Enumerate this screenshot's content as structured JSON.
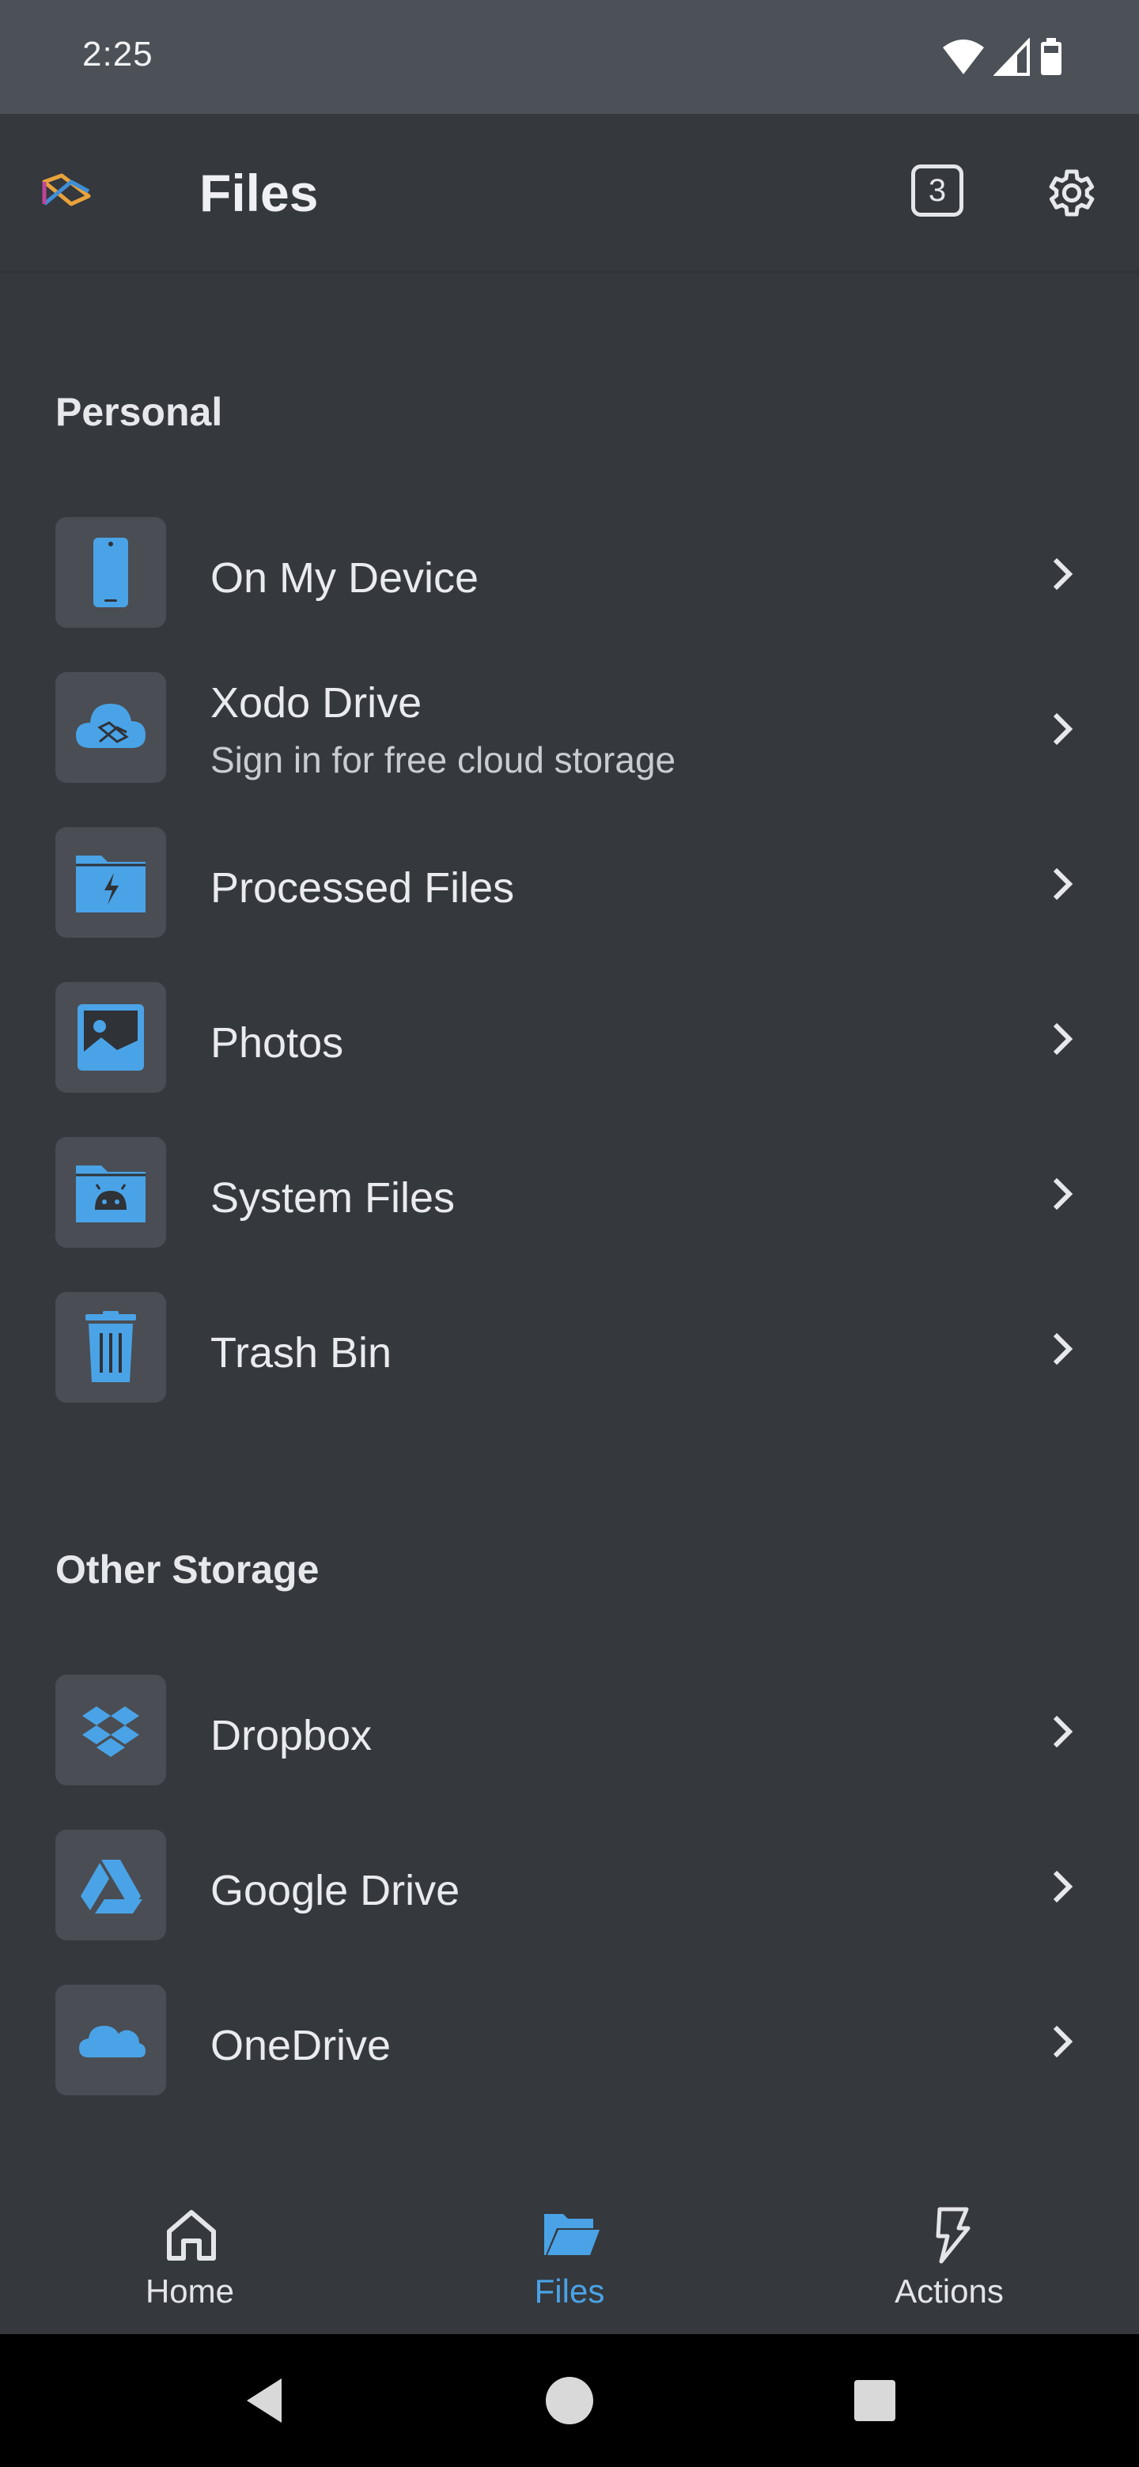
{
  "status_bar": {
    "time": "2:25"
  },
  "app_bar": {
    "title": "Files",
    "tab_count": "3"
  },
  "sections": {
    "personal": {
      "title": "Personal",
      "items": [
        {
          "label": "On My Device",
          "icon": "phone-icon"
        },
        {
          "label": "Xodo Drive",
          "sublabel": "Sign in for free cloud storage",
          "icon": "cloud-icon"
        },
        {
          "label": "Processed Files",
          "icon": "folder-bolt-icon"
        },
        {
          "label": "Photos",
          "icon": "image-icon"
        },
        {
          "label": "System Files",
          "icon": "android-folder-icon"
        },
        {
          "label": "Trash Bin",
          "icon": "trash-icon"
        }
      ]
    },
    "other": {
      "title": "Other Storage",
      "items": [
        {
          "label": "Dropbox",
          "icon": "dropbox-icon"
        },
        {
          "label": "Google Drive",
          "icon": "google-drive-icon"
        },
        {
          "label": "OneDrive",
          "icon": "onedrive-icon"
        }
      ]
    }
  },
  "bottom_nav": {
    "items": [
      {
        "label": "Home",
        "icon": "home-icon"
      },
      {
        "label": "Files",
        "icon": "folder-open-icon",
        "active": true
      },
      {
        "label": "Actions",
        "icon": "bolt-icon"
      }
    ]
  },
  "colors": {
    "background": "#35383d",
    "status_bar": "#4c5057",
    "accent": "#4aa3e6",
    "icon_tile": "#4a4d53"
  }
}
